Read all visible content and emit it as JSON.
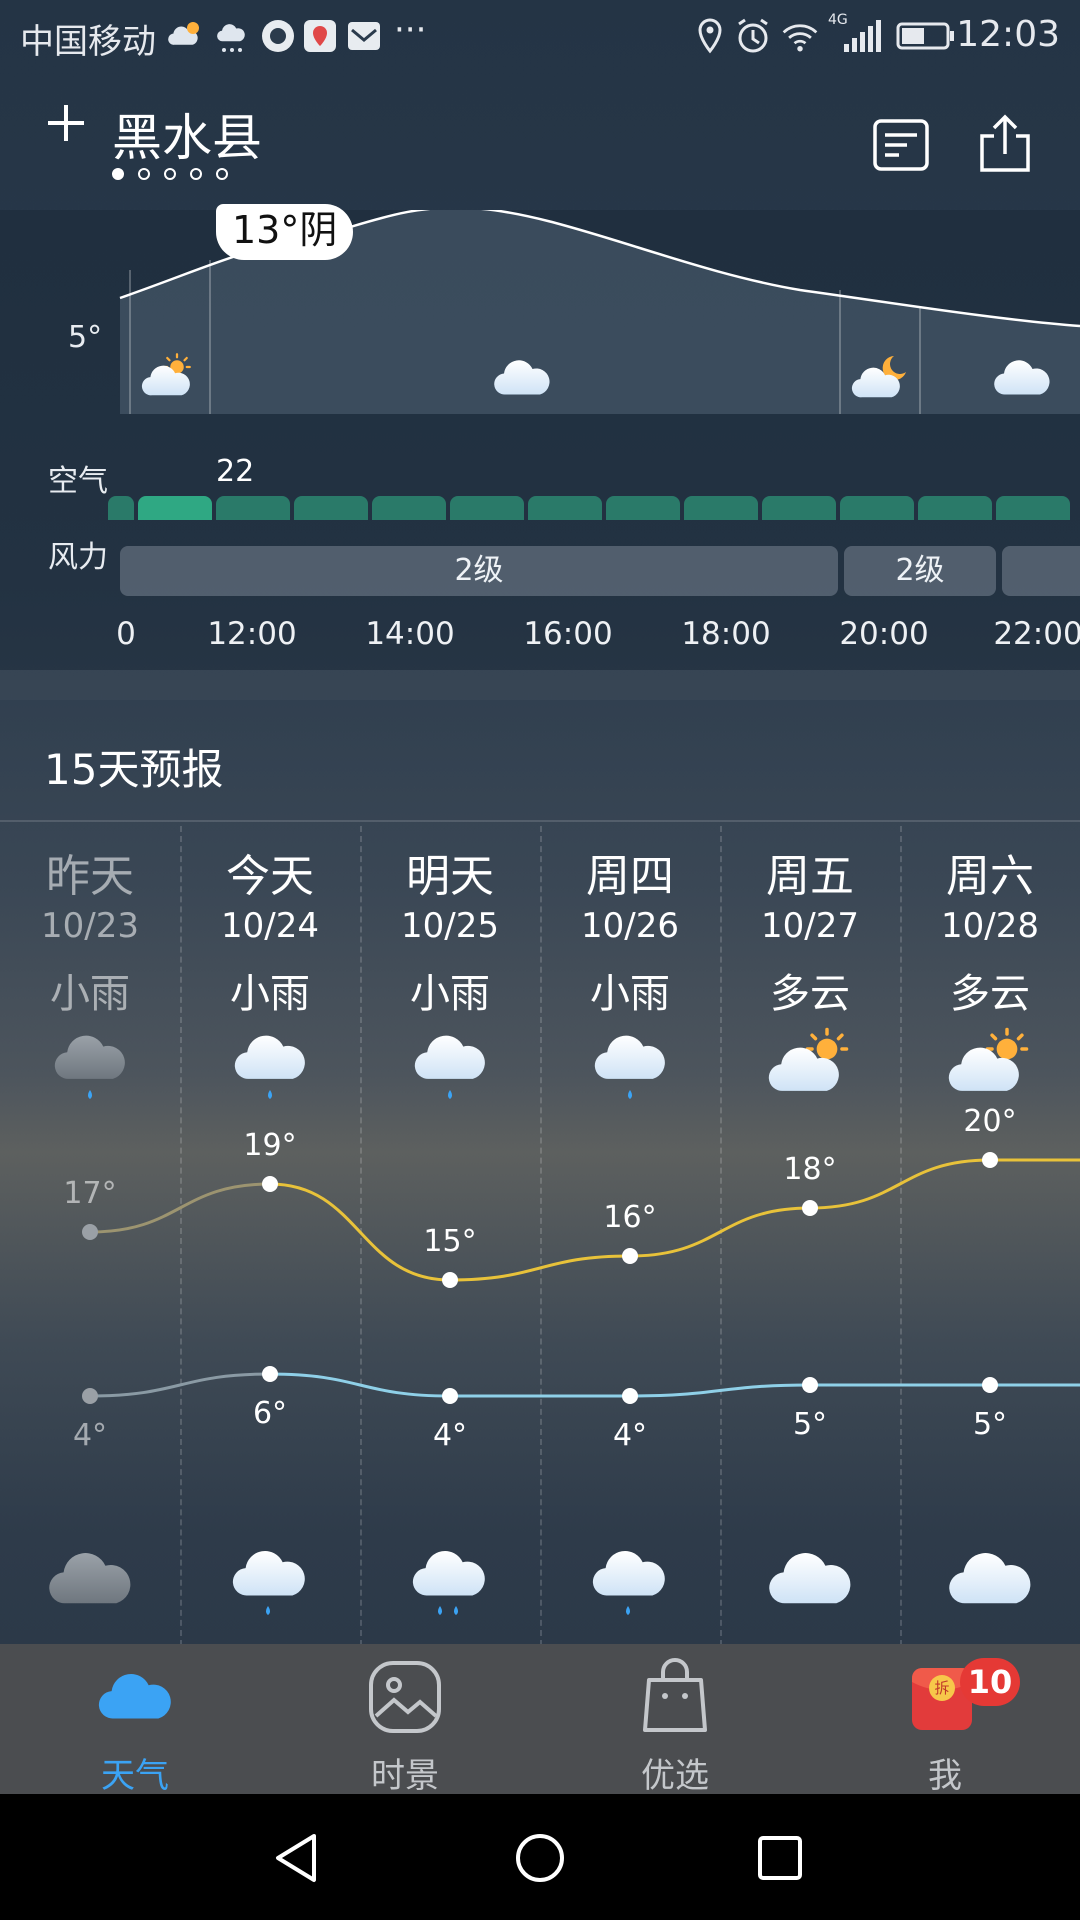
{
  "status_bar": {
    "carrier": "中国移动",
    "network": "4G",
    "time": "12:03"
  },
  "header": {
    "add_icon": "plus-icon",
    "city": "黑水县",
    "page_count": 5,
    "active_page": 0
  },
  "hourly": {
    "current_temp_label": "13°阴",
    "axis_temp_label": "5°",
    "air_label": "空气",
    "air_value": "22",
    "wind_label": "风力",
    "wind_segments": [
      {
        "label": "2级"
      },
      {
        "label": "2级"
      }
    ],
    "times": [
      "0",
      "12:00",
      "14:00",
      "16:00",
      "18:00",
      "20:00",
      "22:00"
    ]
  },
  "forecast": {
    "title": "15天预报",
    "days": [
      {
        "name": "昨天",
        "date": "10/23",
        "day_cond": "小雨",
        "high": "17°",
        "low": "4°",
        "day_icon": "light-rain-icon",
        "night_icon": "cloudy-icon",
        "past": true
      },
      {
        "name": "今天",
        "date": "10/24",
        "day_cond": "小雨",
        "high": "19°",
        "low": "6°",
        "day_icon": "light-rain-icon",
        "night_icon": "light-rain-icon",
        "past": false
      },
      {
        "name": "明天",
        "date": "10/25",
        "day_cond": "小雨",
        "high": "15°",
        "low": "4°",
        "day_icon": "light-rain-icon",
        "night_icon": "moderate-rain-icon",
        "past": false
      },
      {
        "name": "周四",
        "date": "10/26",
        "day_cond": "小雨",
        "high": "16°",
        "low": "4°",
        "day_icon": "light-rain-icon",
        "night_icon": "light-rain-icon",
        "past": false
      },
      {
        "name": "周五",
        "date": "10/27",
        "day_cond": "多云",
        "high": "18°",
        "low": "5°",
        "day_icon": "partly-cloudy-icon",
        "night_icon": "cloudy-icon",
        "past": false
      },
      {
        "name": "周六",
        "date": "10/28",
        "day_cond": "多云",
        "high": "20°",
        "low": "5°",
        "day_icon": "partly-cloudy-icon",
        "night_icon": "cloudy-icon",
        "past": false
      }
    ]
  },
  "tabs": [
    {
      "label": "天气",
      "icon": "cloud-icon",
      "active": true
    },
    {
      "label": "时景",
      "icon": "photo-icon",
      "active": false
    },
    {
      "label": "优选",
      "icon": "shopping-bag-icon",
      "active": false
    },
    {
      "label": "我",
      "icon": "red-packet-icon",
      "active": false
    }
  ],
  "me_badge": "10",
  "colors": {
    "accent": "#3ba3f4",
    "high_line": "#e8c23a",
    "low_line": "#8fd0e8",
    "air_good": "#2a7a69"
  }
}
